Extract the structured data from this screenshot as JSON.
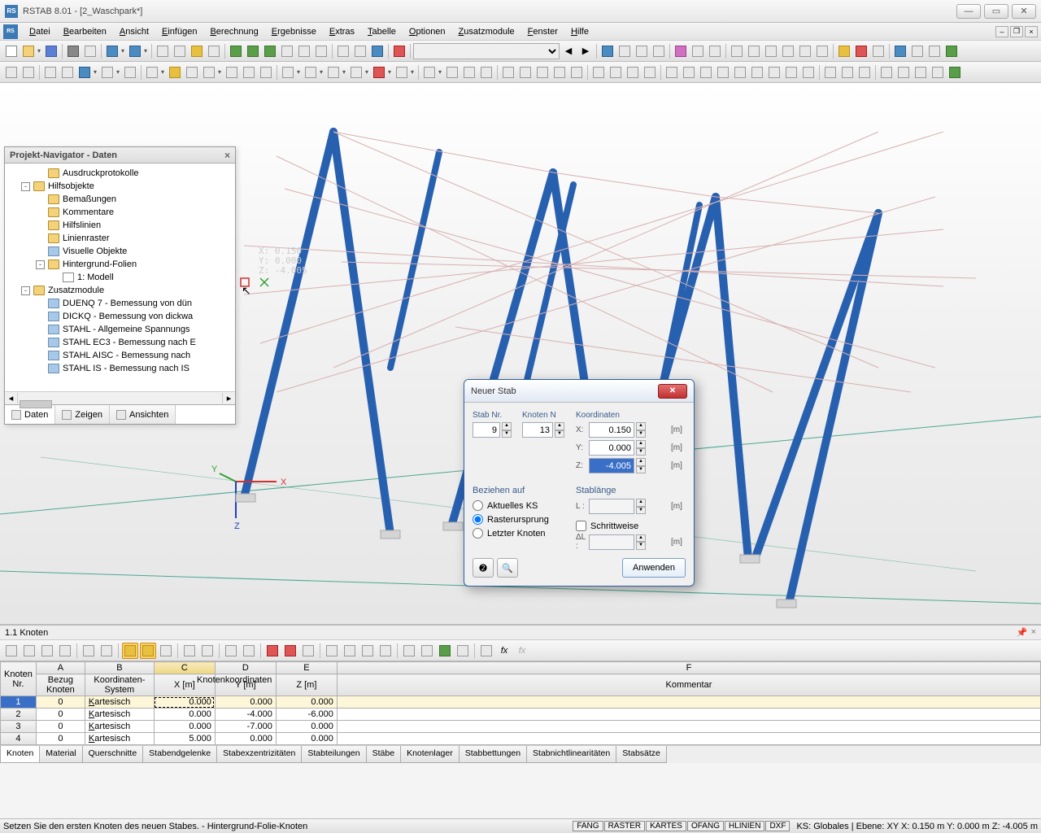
{
  "app": {
    "title": "RSTAB 8.01 - [2_Waschpark*]",
    "icon_text": "RS"
  },
  "menus": [
    "Datei",
    "Bearbeiten",
    "Ansicht",
    "Einfügen",
    "Berechnung",
    "Ergebnisse",
    "Extras",
    "Tabelle",
    "Optionen",
    "Zusatzmodule",
    "Fenster",
    "Hilfe"
  ],
  "navigator": {
    "title": "Projekt-Navigator - Daten",
    "tree": [
      {
        "label": "Ausdruckprotokolle",
        "icon": "folder",
        "indent": 1
      },
      {
        "label": "Hilfsobjekte",
        "icon": "folder",
        "indent": 0,
        "toggle": "-"
      },
      {
        "label": "Bemaßungen",
        "icon": "folder",
        "indent": 1
      },
      {
        "label": "Kommentare",
        "icon": "folder",
        "indent": 1
      },
      {
        "label": "Hilfslinien",
        "icon": "folder",
        "indent": 1
      },
      {
        "label": "Linienraster",
        "icon": "folder",
        "indent": 1
      },
      {
        "label": "Visuelle Objekte",
        "icon": "mod",
        "indent": 1
      },
      {
        "label": "Hintergrund-Folien",
        "icon": "folder",
        "indent": 1,
        "toggle": "-"
      },
      {
        "label": "1: Modell",
        "icon": "layer",
        "indent": 2
      },
      {
        "label": "Zusatzmodule",
        "icon": "folder",
        "indent": 0,
        "toggle": "-"
      },
      {
        "label": "DUENQ 7 - Bemessung von dün",
        "icon": "mod",
        "indent": 1
      },
      {
        "label": "DICKQ - Bemessung von dickwa",
        "icon": "mod",
        "indent": 1
      },
      {
        "label": "STAHL - Allgemeine Spannungs",
        "icon": "mod",
        "indent": 1
      },
      {
        "label": "STAHL EC3 - Bemessung nach E",
        "icon": "mod",
        "indent": 1
      },
      {
        "label": "STAHL AISC - Bemessung nach",
        "icon": "mod",
        "indent": 1
      },
      {
        "label": "STAHL IS - Bemessung nach IS",
        "icon": "mod",
        "indent": 1
      }
    ],
    "tabs": [
      "Daten",
      "Zeigen",
      "Ansichten"
    ]
  },
  "dialog": {
    "title": "Neuer Stab",
    "stab_label": "Stab Nr.",
    "stab_val": "9",
    "knoten_label": "Knoten N",
    "knoten_val": "13",
    "koord_label": "Koordinaten",
    "coords": [
      {
        "axis": "X:",
        "val": "0.150",
        "unit": "[m]"
      },
      {
        "axis": "Y:",
        "val": "0.000",
        "unit": "[m]"
      },
      {
        "axis": "Z:",
        "val": "-4.005",
        "unit": "[m]",
        "sel": true
      }
    ],
    "bezug_label": "Beziehen auf",
    "bezug_options": [
      {
        "label": "Aktuelles KS",
        "checked": false
      },
      {
        "label": "Rasterursprung",
        "checked": true
      },
      {
        "label": "Letzter Knoten",
        "checked": false
      }
    ],
    "stablen_label": "Stablänge",
    "stablen_axis": "L :",
    "stablen_unit": "[m]",
    "schritt_label": "Schrittweise",
    "schritt_axis": "ΔL :",
    "schritt_unit": "[m]",
    "apply": "Anwenden"
  },
  "table_panel": {
    "title": "1.1 Knoten",
    "col_letters": [
      "A",
      "B",
      "C",
      "D",
      "E",
      "F"
    ],
    "headers_group": {
      "knoten": "Knoten\nNr.",
      "bezug": "Bezug Knoten",
      "ks": "Koordinaten-System",
      "kk": "Knotenkoordinaten",
      "komm": "Kommentar"
    },
    "sub": [
      "X [m]",
      "Y [m]",
      "Z [m]"
    ],
    "rows": [
      {
        "nr": "1",
        "bezug": "0",
        "ks": "Kartesisch",
        "x": "0.000",
        "y": "0.000",
        "z": "0.000",
        "sel": true
      },
      {
        "nr": "2",
        "bezug": "0",
        "ks": "Kartesisch",
        "x": "0.000",
        "y": "-4.000",
        "z": "-6.000"
      },
      {
        "nr": "3",
        "bezug": "0",
        "ks": "Kartesisch",
        "x": "0.000",
        "y": "-7.000",
        "z": "0.000"
      },
      {
        "nr": "4",
        "bezug": "0",
        "ks": "Kartesisch",
        "x": "5.000",
        "y": "0.000",
        "z": "0.000"
      }
    ],
    "tabs": [
      "Knoten",
      "Material",
      "Querschnitte",
      "Stabendgelenke",
      "Stabexzentrizitäten",
      "Stabteilungen",
      "Stäbe",
      "Knotenlager",
      "Stabbettungen",
      "Stabnichtlinearitäten",
      "Stabsätze"
    ]
  },
  "status": {
    "msg": "Setzen Sie den ersten Knoten des neuen Stabes. - Hintergrund-Folie-Knoten",
    "toggles": [
      "FANG",
      "RASTER",
      "KARTES",
      "OFANG",
      "HLINIEN",
      "DXF"
    ],
    "info": "KS: Globales | Ebene: XY  X: 0.150 m      Y: 0.000 m      Z: -4.005 m"
  },
  "viewport_coords": {
    "x": "X:   0.150",
    "y": "Y:   0.000",
    "z": "Z:  -4.005"
  }
}
